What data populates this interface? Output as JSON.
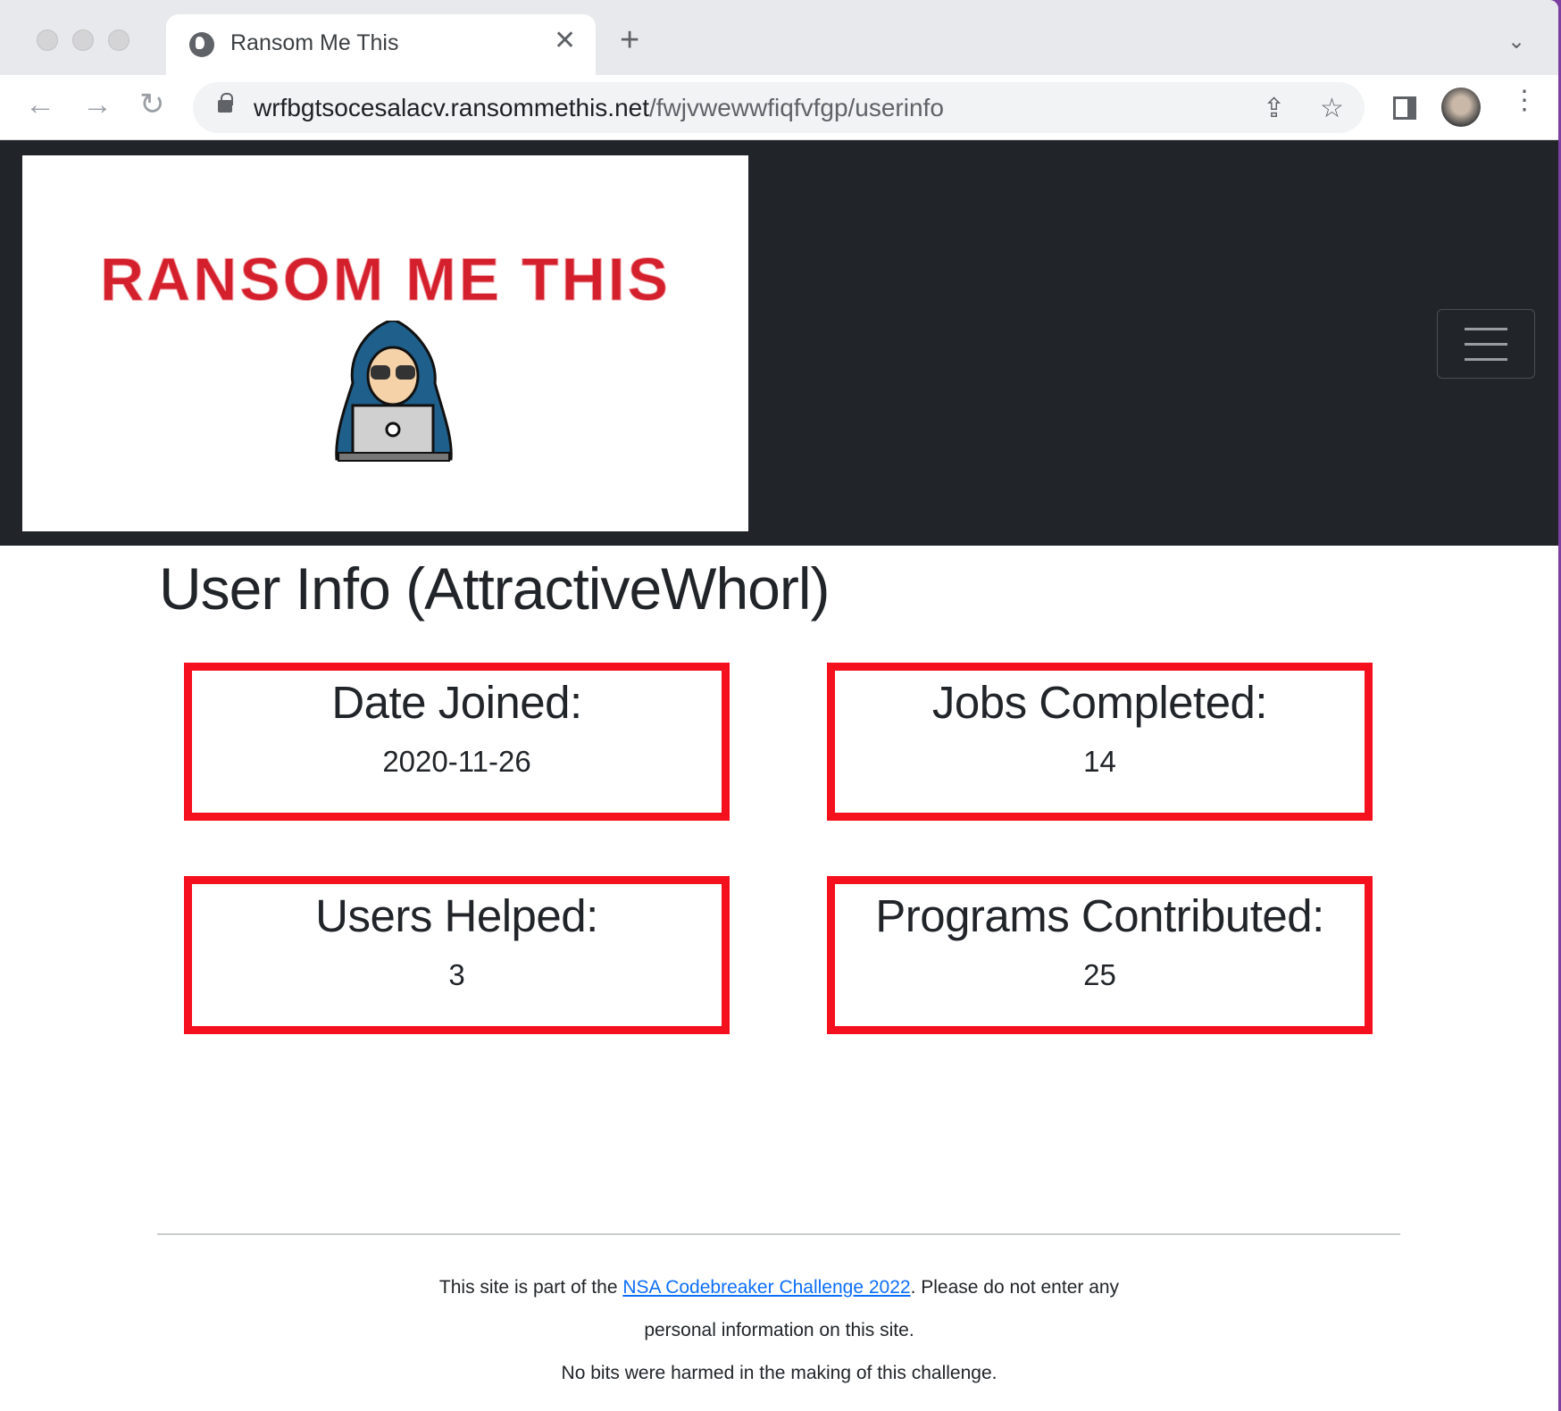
{
  "browser": {
    "tab_title": "Ransom Me This",
    "url_host": "wrfbgtsocesalacv.ransommethis.net",
    "url_path": "/fwjvwewwfiqfvfgp/userinfo"
  },
  "navbar": {
    "logo_text": "RANSOM ME THIS"
  },
  "page": {
    "title": "User Info (AttractiveWhorl)",
    "stats": [
      {
        "label": "Date Joined:",
        "value": "2020-11-26"
      },
      {
        "label": "Jobs Completed:",
        "value": "14"
      },
      {
        "label": "Users Helped:",
        "value": "3"
      },
      {
        "label": "Programs Contributed:",
        "value": "25"
      }
    ],
    "accent_color": "#f5101e"
  },
  "footer": {
    "line1_pre": "This site is part of the ",
    "link": "NSA Codebreaker Challenge 2022",
    "line1_post": ". Please do not enter any",
    "line2": "personal information on this site.",
    "line3": "No bits were harmed in the making of this challenge."
  }
}
